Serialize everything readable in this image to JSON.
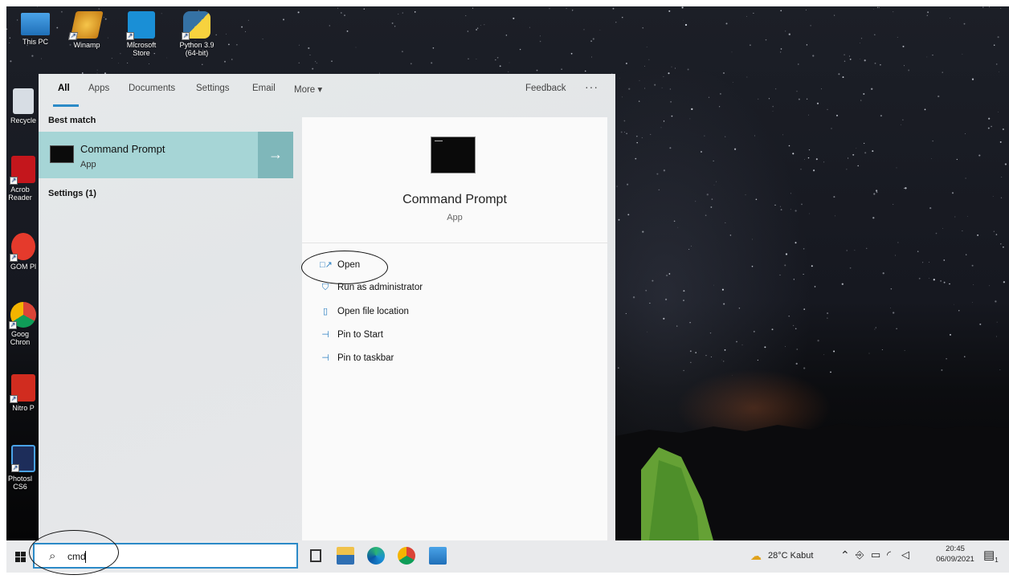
{
  "desktop_icons": [
    {
      "label": "This PC"
    },
    {
      "label": "Winamp"
    },
    {
      "label": "Microsoft Store"
    },
    {
      "label": "Python 3.9 (64-bit)"
    },
    {
      "label": "Recycle"
    },
    {
      "label": "Acrob Reader"
    },
    {
      "label": "GOM Pl"
    },
    {
      "label": "Goog Chron"
    },
    {
      "label": "Nitro P"
    },
    {
      "label": "Photosl CS6"
    }
  ],
  "start_panel": {
    "tabs": [
      "All",
      "Apps",
      "Documents",
      "Settings",
      "Email",
      "More ▾"
    ],
    "feedback_label": "Feedback",
    "more_options": "···",
    "best_match_label": "Best match",
    "best_match": {
      "title": "Command Prompt",
      "subtitle": "App"
    },
    "settings_label": "Settings (1)",
    "details": {
      "title": "Command Prompt",
      "subtitle": "App",
      "actions": [
        {
          "label": "Open",
          "icon": "open-icon"
        },
        {
          "label": "Run as administrator",
          "icon": "admin-shield-icon"
        },
        {
          "label": "Open file location",
          "icon": "file-location-icon"
        },
        {
          "label": "Pin to Start",
          "icon": "pin-icon"
        },
        {
          "label": "Pin to taskbar",
          "icon": "pin-icon"
        }
      ]
    }
  },
  "taskbar": {
    "search_value": "cmd",
    "weather": "28°C  Kabut",
    "time": "20:45",
    "date": "06/09/2021",
    "notification_count": "1"
  },
  "colors": {
    "accent": "#2b8ac7",
    "best_match_bg": "#a6d5d6",
    "taskbar": "#e9eaec"
  }
}
